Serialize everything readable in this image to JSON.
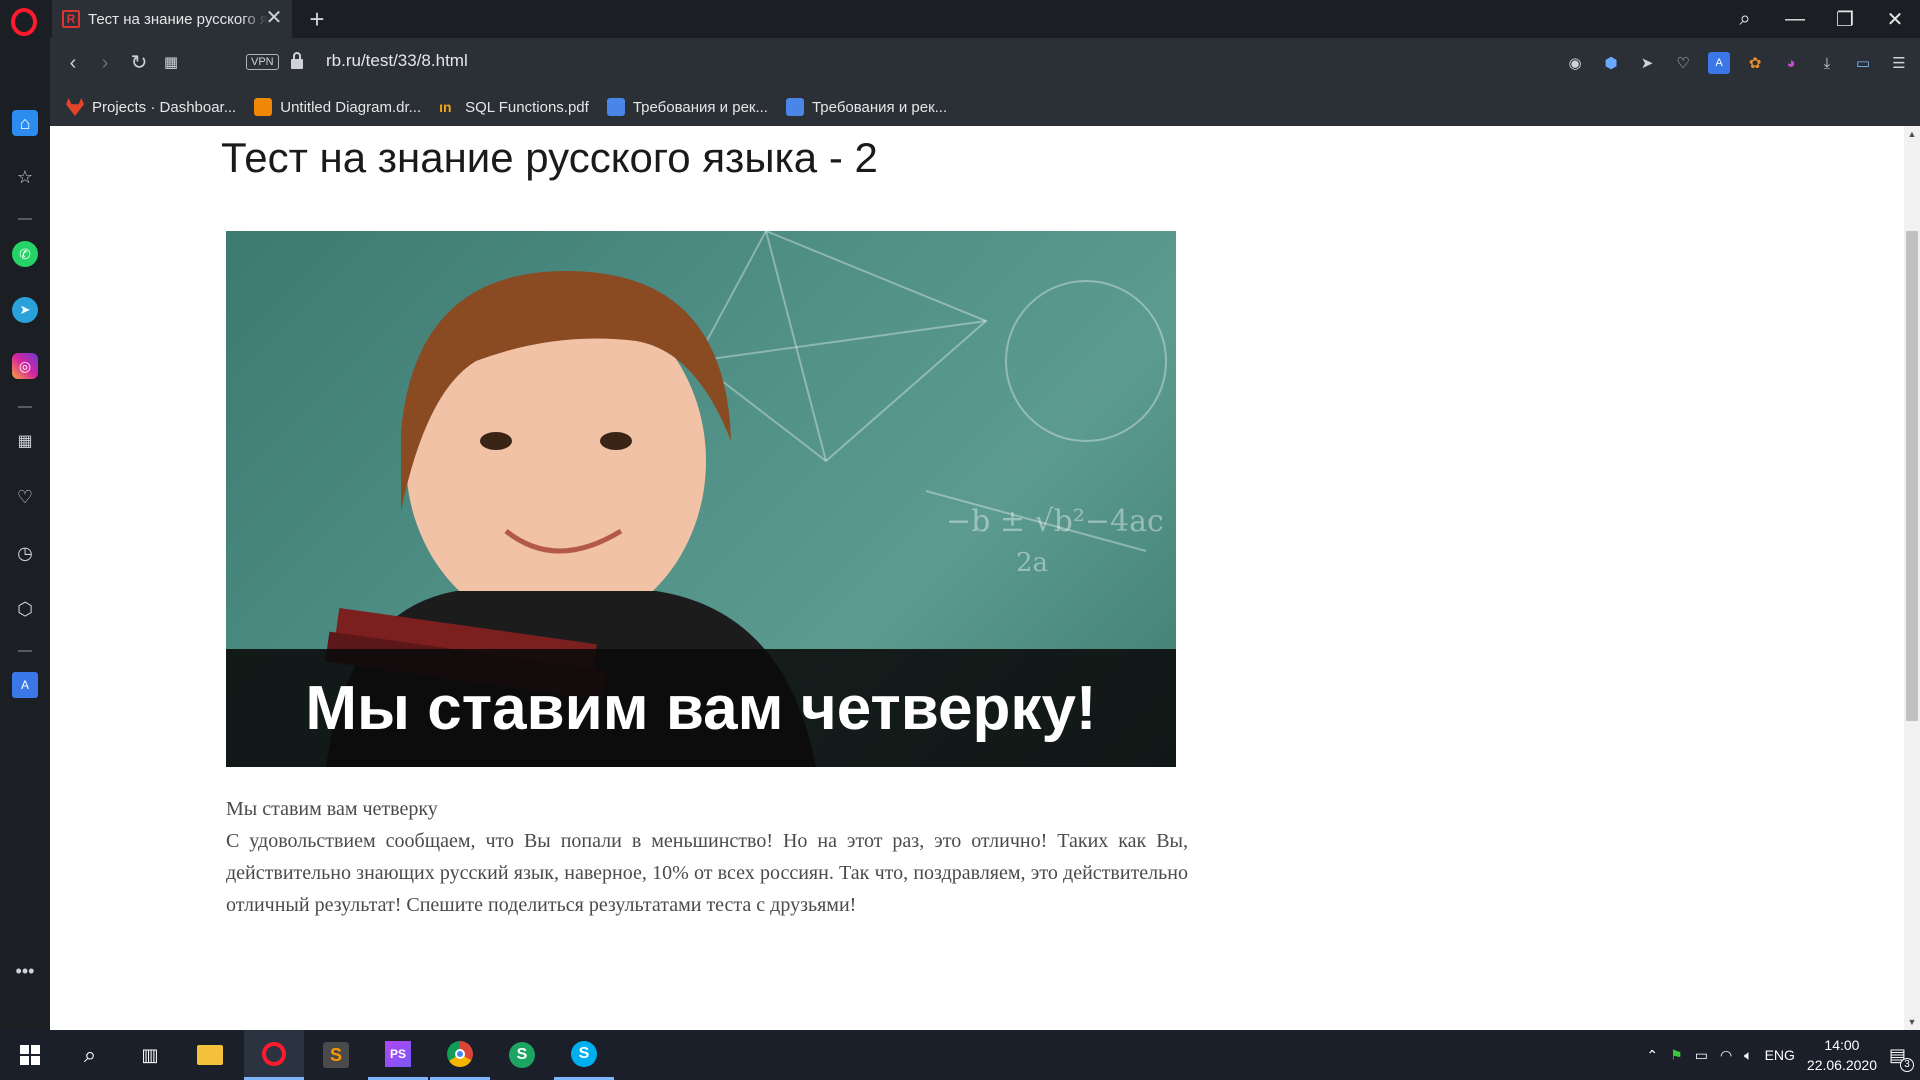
{
  "browser": {
    "tab_title": "Тест на знание русского я",
    "tab_favicon": "R",
    "url": "rb.ru/test/33/8.html",
    "vpn_label": "VPN",
    "new_tab": "+",
    "close_tab": "✕",
    "window": {
      "search": "⌕",
      "minimize": "—",
      "restore": "❐",
      "close": "✕"
    }
  },
  "bookmarks": [
    {
      "label": "Projects · Dashboar...",
      "icon": "gitlab-icon",
      "color": "#e24329"
    },
    {
      "label": "Untitled Diagram.dr...",
      "icon": "drawio-icon",
      "color": "#f08705"
    },
    {
      "label": "SQL Functions.pdf",
      "icon": "pdf-icon",
      "color": "#f2a31b"
    },
    {
      "label": "Требования и рек...",
      "icon": "docs-icon",
      "color": "#4a86e8"
    },
    {
      "label": "Требования и рек...",
      "icon": "docs-icon",
      "color": "#4a86e8"
    }
  ],
  "page": {
    "title": "Тест на знание русского языка - 2",
    "hero_caption": "Мы ставим вам четверку!",
    "result_heading": "Мы ставим вам четверку",
    "result_text": "С удовольствием сообщаем, что Вы попали в меньшинство! Но на этот раз, это отлично! Таких как Вы, действительно знающих русский язык, наверное, 10% от всех россиян. Так что, поздравляем, это действительно отличный результат! Спешите поделиться результатами теста с друзьями!"
  },
  "taskbar": {
    "language": "ENG",
    "time": "14:00",
    "date": "22.06.2020",
    "notification_count": "3"
  },
  "colors": {
    "accent": "#7fb4ff",
    "opera_red": "#ff1b2d",
    "chalkboard": "#4e8e84"
  }
}
